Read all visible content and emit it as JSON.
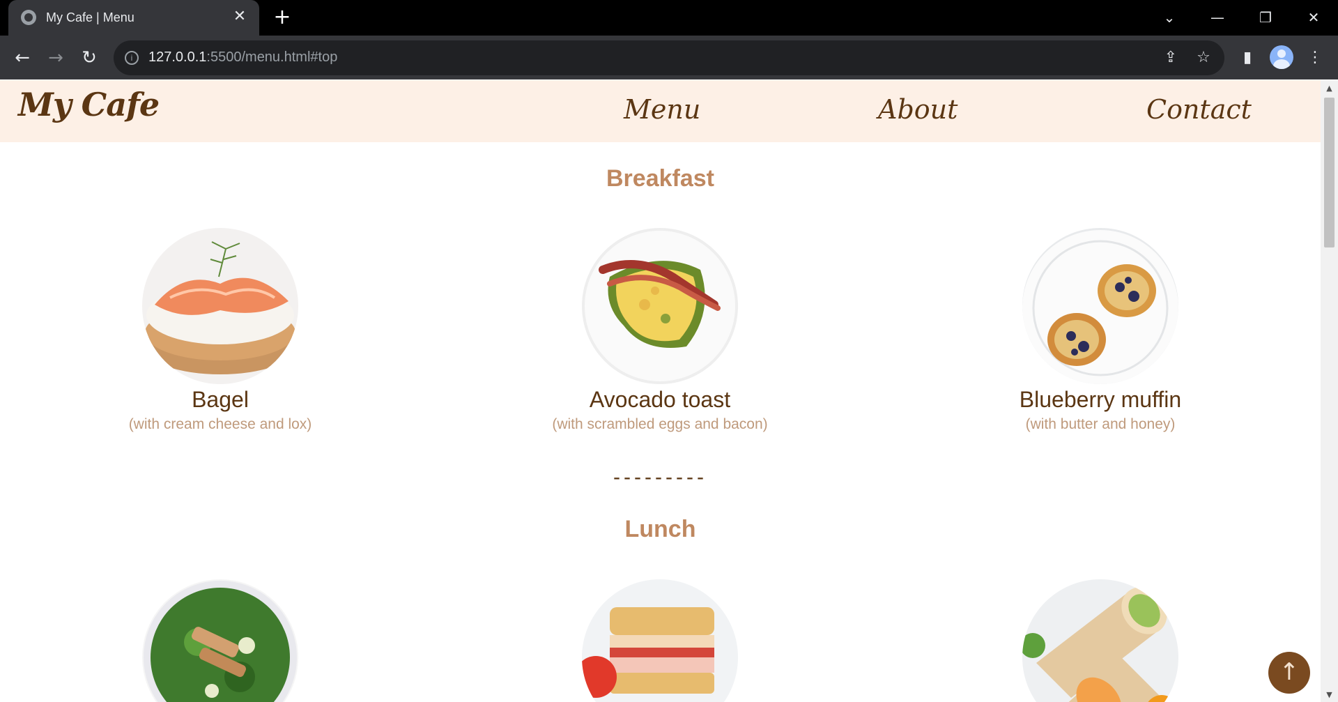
{
  "browser": {
    "tab_title": "My Cafe | Menu",
    "tab_close": "✕",
    "new_tab": "+",
    "url_host": "127.0.0.1",
    "url_rest": ":5500/menu.html#top",
    "window_controls": {
      "dropdown": "⌄",
      "minimize": "—",
      "restore": "❐",
      "close": "✕"
    },
    "nav": {
      "back": "←",
      "forward": "→",
      "reload": "↻",
      "info": "i",
      "share": "⇪",
      "star": "☆",
      "sidepanel": "▮",
      "menu": "⋮"
    }
  },
  "site": {
    "logo": "My Cafe",
    "nav": [
      "Menu",
      "About",
      "Contact"
    ]
  },
  "breakfast": {
    "title": "Breakfast",
    "items": [
      {
        "name": "Bagel",
        "desc": "(with cream cheese and lox)"
      },
      {
        "name": "Avocado toast",
        "desc": "(with scrambled eggs and bacon)"
      },
      {
        "name": "Blueberry muffin",
        "desc": "(with butter and honey)"
      }
    ]
  },
  "divider": "---------",
  "lunch": {
    "title": "Lunch"
  },
  "back_to_top": "↑",
  "colors": {
    "header_bg": "#fdf0e6",
    "brand_brown": "#5b3613",
    "accent_tan": "#bf8860",
    "button_brown": "#7a4a20"
  },
  "icons": [
    "globe-icon",
    "close-icon",
    "plus-icon",
    "back-arrow-icon",
    "forward-arrow-icon",
    "reload-icon",
    "info-icon",
    "share-icon",
    "star-icon",
    "sidepanel-icon",
    "profile-icon",
    "kebab-menu-icon",
    "arrow-up-icon"
  ]
}
